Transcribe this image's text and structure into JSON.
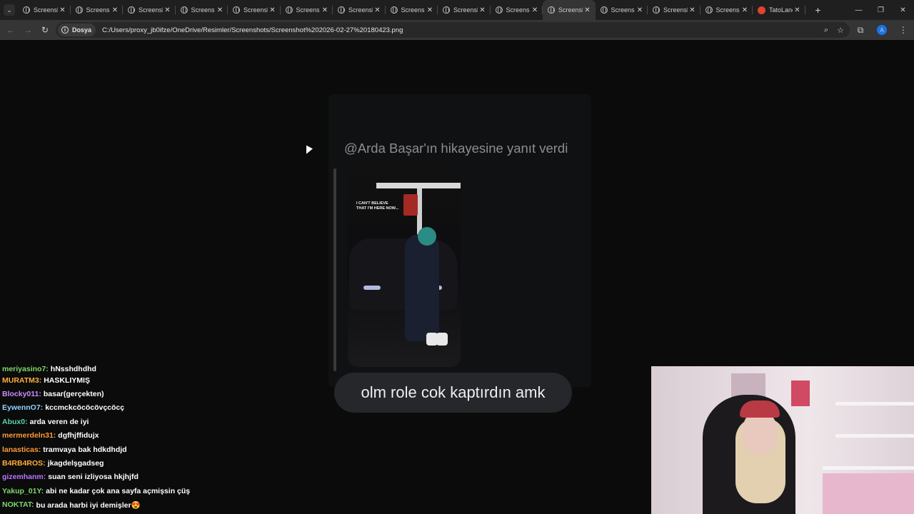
{
  "browser": {
    "tabs": [
      {
        "title": "Screenshot",
        "active": false,
        "icon": "globe-icon"
      },
      {
        "title": "Screenshot",
        "active": false,
        "icon": "globe-icon"
      },
      {
        "title": "Screenshot",
        "active": false,
        "icon": "globe-icon"
      },
      {
        "title": "Screenshot",
        "active": false,
        "icon": "globe-icon"
      },
      {
        "title": "Screenshot",
        "active": false,
        "icon": "globe-icon"
      },
      {
        "title": "Screenshot",
        "active": false,
        "icon": "globe-icon"
      },
      {
        "title": "Screenshot",
        "active": false,
        "icon": "globe-icon"
      },
      {
        "title": "Screenshot",
        "active": false,
        "icon": "globe-icon"
      },
      {
        "title": "Screenshot",
        "active": false,
        "icon": "globe-icon"
      },
      {
        "title": "Screenshot",
        "active": false,
        "icon": "globe-icon"
      },
      {
        "title": "Screenshot",
        "active": true,
        "icon": "globe-icon"
      },
      {
        "title": "Screenshot",
        "active": false,
        "icon": "globe-icon"
      },
      {
        "title": "Screenshot",
        "active": false,
        "icon": "globe-icon"
      },
      {
        "title": "Screenshot",
        "active": false,
        "icon": "globe-icon"
      },
      {
        "title": "TatoLand",
        "active": false,
        "icon": "red-favicon-icon"
      }
    ],
    "close_glyph": "✕",
    "new_tab_glyph": "+",
    "address": {
      "site_info_label": "Dosya",
      "url": "C:/Users/proxy_jb0ifze/OneDrive/Resimler/Screenshots/Screenshot%202026-02-27%20180423.png"
    },
    "profile_initial": "A"
  },
  "story_reply": {
    "header": "@Arda Başar'ın hikayesine yanıt verdi",
    "story_overlay_text": "I CAN'T BELIEVE THAT I'M HERE NOW...",
    "message": "olm role cok kaptırdın amk"
  },
  "chat": {
    "messages": [
      {
        "user": "meriyasino7:",
        "text": "hNsshdhdhd",
        "color": "#7fd86a",
        "cut": true
      },
      {
        "user": "MURATM3:",
        "text": "HASKLIYMIŞ",
        "color": "#ffae3c"
      },
      {
        "user": "Blocky011:",
        "text": "basar(gerçekten)",
        "color": "#c98cff"
      },
      {
        "user": "EywennO7:",
        "text": "kccmckcöcöcövçcöcç",
        "color": "#8fd3ff"
      },
      {
        "user": "Abux0:",
        "text": "arda veren de iyi",
        "color": "#58d6a6"
      },
      {
        "user": "mermerdeln31:",
        "text": "dgfhjffidujx",
        "color": "#ff9a3c"
      },
      {
        "user": "lanasticas:",
        "text": "tramvaya bak hdkdhdjd",
        "color": "#ff9a3c"
      },
      {
        "user": "B4RB4ROS:",
        "text": "jkagdelşgadseg",
        "color": "#ffae3c"
      },
      {
        "user": "gizemhanm:",
        "text": "suan seni izliyosa hkjhjfd",
        "color": "#b777ff"
      },
      {
        "user": "Yakup_01Y:",
        "text": "abi ne kadar çok ana sayfa açmişsin çüş",
        "color": "#7fd86a"
      },
      {
        "user": "NOKTAT:",
        "text": "bu arada harbi iyi demişler😍",
        "color": "#7fd86a"
      }
    ]
  }
}
